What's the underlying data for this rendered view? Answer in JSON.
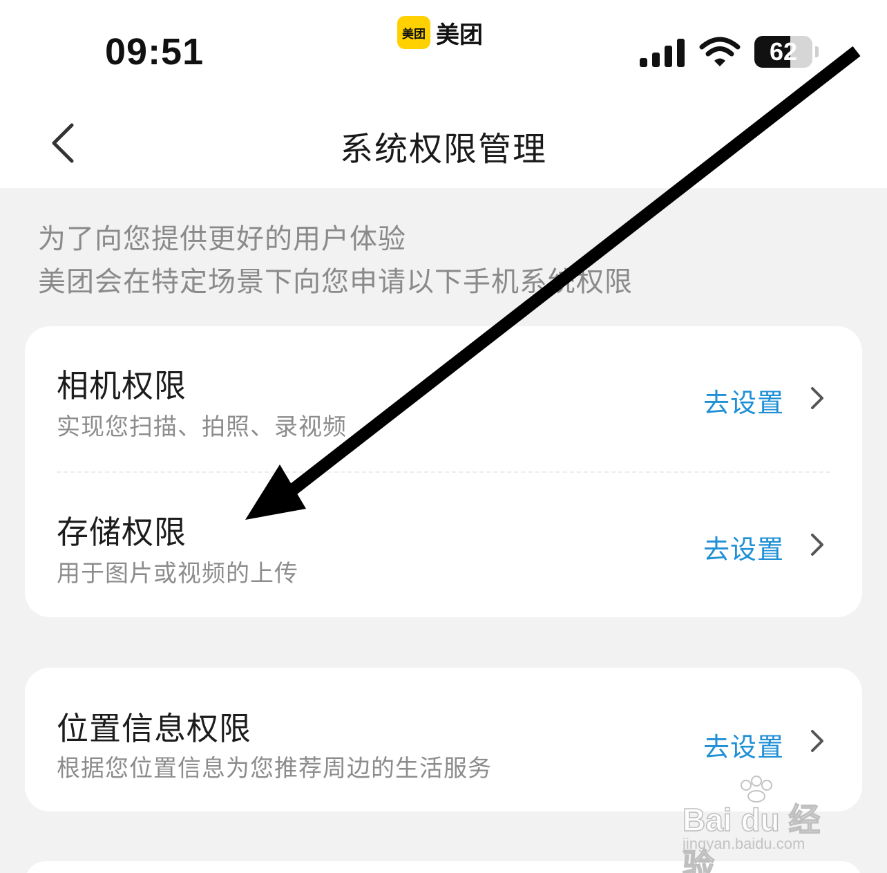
{
  "status_bar": {
    "time": "09:51",
    "app_badge_logo_text": "美团",
    "app_badge_name": "美团",
    "battery_level": "62",
    "battery_fraction": 0.62,
    "icons": [
      "signal-icon",
      "wifi-icon",
      "battery-icon"
    ]
  },
  "nav": {
    "back_icon": "chevron-left-icon",
    "title": "系统权限管理"
  },
  "intro": {
    "line1": "为了向您提供更好的用户体验",
    "line2": "美团会在特定场景下向您申请以下手机系统权限"
  },
  "permissions": [
    {
      "title": "相机权限",
      "desc": "实现您扫描、拍照、录视频",
      "action": "去设置"
    },
    {
      "title": "存储权限",
      "desc": "用于图片或视频的上传",
      "action": "去设置"
    },
    {
      "title": "位置信息权限",
      "desc": "根据您位置信息为您推荐周边的生活服务",
      "action": "去设置"
    }
  ],
  "colors": {
    "page_background": "#f2f2f2",
    "card_background": "#ffffff",
    "action_blue": "#1f8fd6",
    "brand_yellow": "#ffd100"
  },
  "watermark": {
    "brand": "Bai du 经验",
    "url": "jingyan.baidu.com"
  }
}
